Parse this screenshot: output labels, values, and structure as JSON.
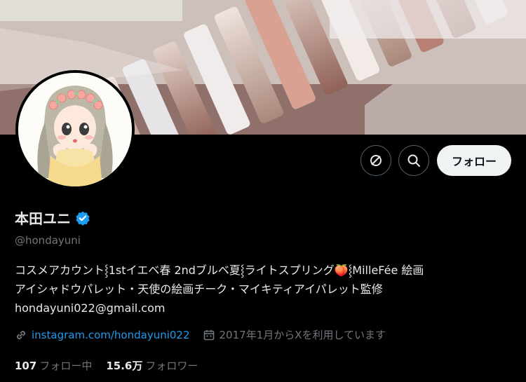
{
  "profile": {
    "name": "本田ユニ",
    "handle": "@hondayuni",
    "bio_line1": "コスメアカウント⸾1stイエベ春 2ndブルベ夏⸾ライトスプリング🍑⸾MilleFée 絵画",
    "bio_line2": "アイシャドウパレット・天使の絵画チーク・マイキティアイパレット監修",
    "bio_line3": "hondayuni022@gmail.com",
    "link": "instagram.com/hondayuni022",
    "joined": "2017年1月からXを利用しています"
  },
  "actions": {
    "follow_label": "フォロー",
    "icons": [
      "grok-icon",
      "search-icon"
    ]
  },
  "stats": {
    "following_count": "107",
    "following_label": "フォロー中",
    "followers_count": "15.6万",
    "followers_label": "フォロワー"
  },
  "colors": {
    "background": "#000000",
    "text": "#e7e9ea",
    "muted": "#71767b",
    "link": "#1d9bf0",
    "verified": "#1d9bf0",
    "follow_button": "#eff3f4"
  }
}
